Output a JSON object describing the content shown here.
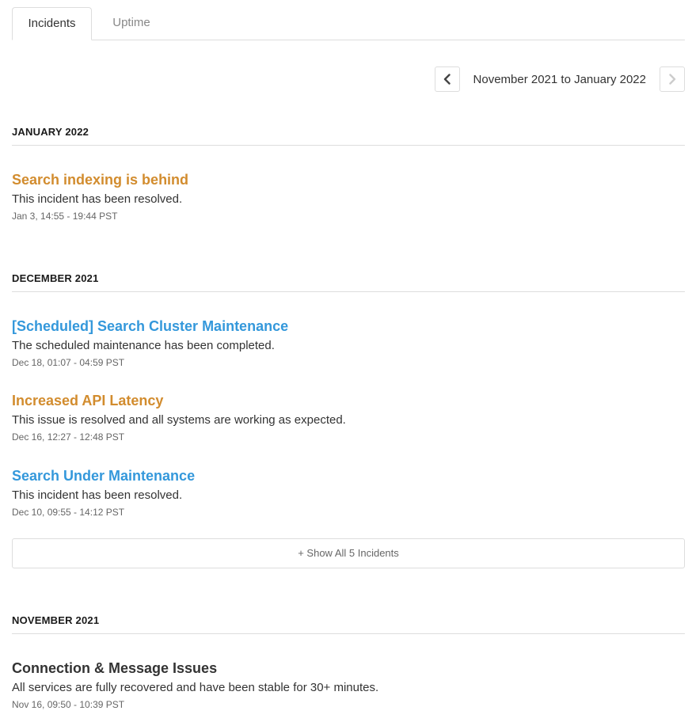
{
  "tabs": [
    {
      "label": "Incidents",
      "active": true
    },
    {
      "label": "Uptime",
      "active": false
    }
  ],
  "pager": {
    "range_label": "November 2021 to January 2022",
    "prev_icon": "chevron-left-icon",
    "next_icon": "chevron-right-icon"
  },
  "colors": {
    "minor": "#d28c2e",
    "maintenance": "#3498db",
    "none": "#333333"
  },
  "months": [
    {
      "title": "JANUARY 2022",
      "incidents": [
        {
          "title": "Search indexing is behind",
          "impact": "minor",
          "message": "This incident has been resolved.",
          "time": "Jan 3, 14:55 - 19:44 PST"
        }
      ]
    },
    {
      "title": "DECEMBER 2021",
      "incidents": [
        {
          "title": "[Scheduled] Search Cluster Maintenance",
          "impact": "maintenance",
          "message": "The scheduled maintenance has been completed.",
          "time": "Dec 18, 01:07 - 04:59 PST"
        },
        {
          "title": "Increased API Latency",
          "impact": "minor",
          "message": "This issue is resolved and all systems are working as expected.",
          "time": "Dec 16, 12:27 - 12:48 PST"
        },
        {
          "title": "Search Under Maintenance",
          "impact": "maintenance",
          "message": "This incident has been resolved.",
          "time": "Dec 10, 09:55 - 14:12 PST"
        }
      ],
      "show_all_label": "+ Show All 5 Incidents"
    },
    {
      "title": "NOVEMBER 2021",
      "incidents": [
        {
          "title": "Connection & Message Issues",
          "impact": "none",
          "message": "All services are fully recovered and have been stable for 30+ minutes.",
          "time": "Nov 16, 09:50 - 10:39 PST"
        }
      ]
    }
  ]
}
